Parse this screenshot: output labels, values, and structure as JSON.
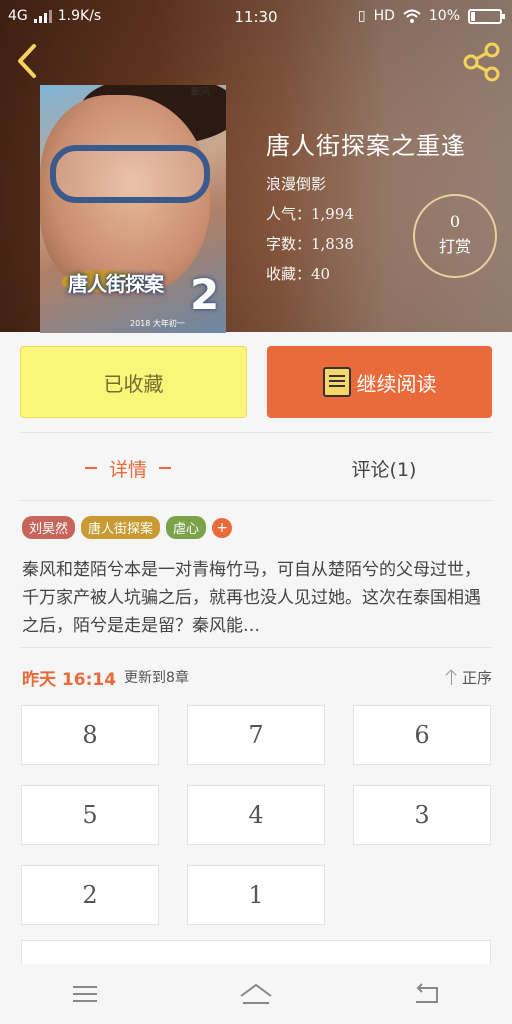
{
  "status_bar": {
    "network": "4G",
    "speed": "1.9K/s",
    "time": "11:30",
    "hd": "HD",
    "battery": "10%"
  },
  "book": {
    "title": "唐人街探案之重逢",
    "author": "浪漫倒影",
    "popularity": "人气：1,994",
    "word_count": "字数：1,838",
    "favorites": "收藏：40"
  },
  "poster": {
    "title_text": "唐人街探案",
    "number": "2",
    "name": "秦风",
    "date": "2018 大年初一"
  },
  "reward": {
    "count": "0",
    "label": "打赏"
  },
  "actions": {
    "favorite_label": "已收藏",
    "read_label": "继续阅读"
  },
  "tabs": {
    "details": "详情",
    "comments": "评论(1)"
  },
  "tags": [
    {
      "label": "刘昊然",
      "color": "#c8655a"
    },
    {
      "label": "唐人街探案",
      "color": "#c99a33"
    },
    {
      "label": "虐心",
      "color": "#7aa34a"
    }
  ],
  "tag_add": "+",
  "description": "秦风和楚陌兮本是一对青梅竹马，可自从楚陌兮的父母过世，千万家产被人坑骗之后，就再也没人见过她。这次在泰国相遇之后，陌兮是走是留？秦风能…",
  "update": {
    "when": "昨天 16:14",
    "text": "更新到8章",
    "order": "正序"
  },
  "chapters": [
    "8",
    "7",
    "6",
    "5",
    "4",
    "3",
    "2",
    "1"
  ],
  "colors": {
    "accent": "#e96a3b",
    "favorite_bg": "#fbf579"
  }
}
